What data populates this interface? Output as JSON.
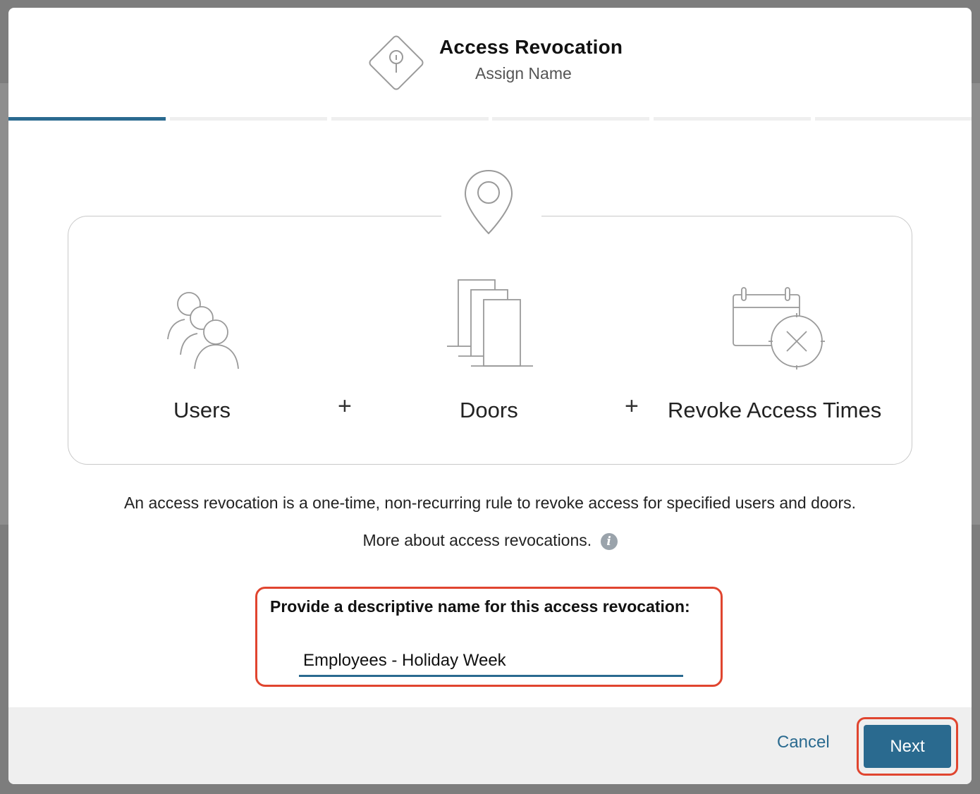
{
  "header": {
    "title": "Access Revocation",
    "subtitle": "Assign Name",
    "logo_icon": "keyhole-diamond-icon"
  },
  "progress": {
    "total_steps": 6,
    "current_step": 1
  },
  "diagram": {
    "top_icon": "location-pin-icon",
    "items": [
      {
        "label": "Users",
        "icon": "users-group-icon"
      },
      {
        "label": "Doors",
        "icon": "doors-icon"
      },
      {
        "label": "Revoke Access Times",
        "icon": "calendar-cancel-icon"
      }
    ],
    "operator": "+"
  },
  "description": {
    "text": "An access revocation is a one-time, non-recurring rule to revoke access for specified users and doors.",
    "more_link": "More about access revocations.",
    "info_icon": "info-icon"
  },
  "name_form": {
    "label": "Provide a descriptive name for this access revocation:",
    "value": "Employees - Holiday Week"
  },
  "footer": {
    "cancel_label": "Cancel",
    "next_label": "Next"
  },
  "colors": {
    "accent": "#2a6a8f",
    "highlight": "#e0452f",
    "footer_bg": "#efefef"
  }
}
